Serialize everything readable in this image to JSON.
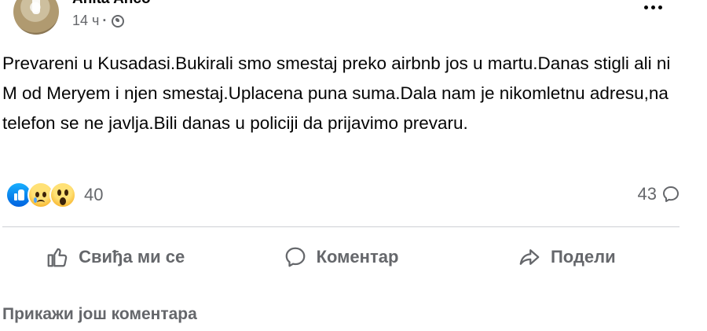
{
  "post": {
    "author_name": "Anita Anco",
    "time": "14 ч",
    "separator": "·",
    "audience_icon": "globe-icon",
    "more_icon": "more-dots-icon",
    "text": "Prevareni u Kusadasi.Bukirali smo smestaj preko airbnb jos u martu.Danas stigli ali ni M od Meryem i njen smestaj.Uplacena puna suma.Dala nam je nikomletnu adresu,na telefon se ne javlja.Bili danas u policiji da prijavimo prevaru."
  },
  "reactions": {
    "icons": [
      "like-icon",
      "sad-icon",
      "wow-icon"
    ],
    "count": "40"
  },
  "comments": {
    "count": "43",
    "icon": "comment-bubble-icon"
  },
  "actions": {
    "like": "Свиђа ми се",
    "comment": "Коментар",
    "share": "Подели"
  },
  "show_more": "Прикажи још коментара",
  "colors": {
    "secondary_text": "#65676b",
    "primary_text": "#050505",
    "divider": "#ced0d4",
    "like_blue": "#0062df"
  }
}
